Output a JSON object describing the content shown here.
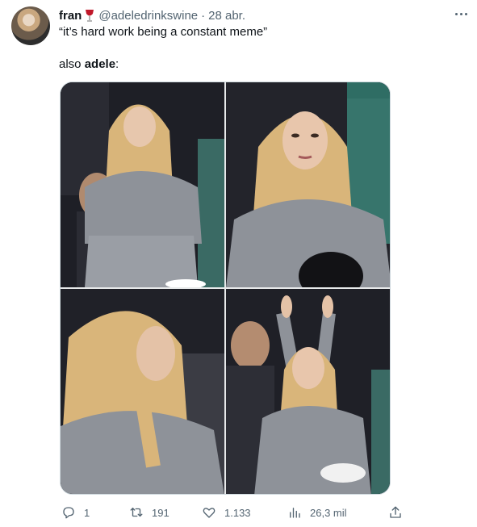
{
  "tweet": {
    "author_name": "fran",
    "handle": "@adeledrinkswine",
    "separator": "·",
    "date": "28 abr.",
    "quote_text": "“it’s hard work being a constant meme”",
    "line2_prefix": "also ",
    "line2_bold": "adele",
    "line2_suffix": ":"
  },
  "actions": {
    "reply_count": "1",
    "retweet_count": "191",
    "like_count": "1.133",
    "views_count": "26,3 mil"
  },
  "colors": {
    "text_primary": "#0f1419",
    "text_secondary": "#536471",
    "border": "#cfd9de",
    "hoodie_gray": "#8e9299",
    "hair_blonde": "#d9b57a"
  },
  "icons": [
    "wine-glass-icon",
    "more-icon",
    "reply-icon",
    "retweet-icon",
    "like-icon",
    "views-icon",
    "share-icon"
  ]
}
